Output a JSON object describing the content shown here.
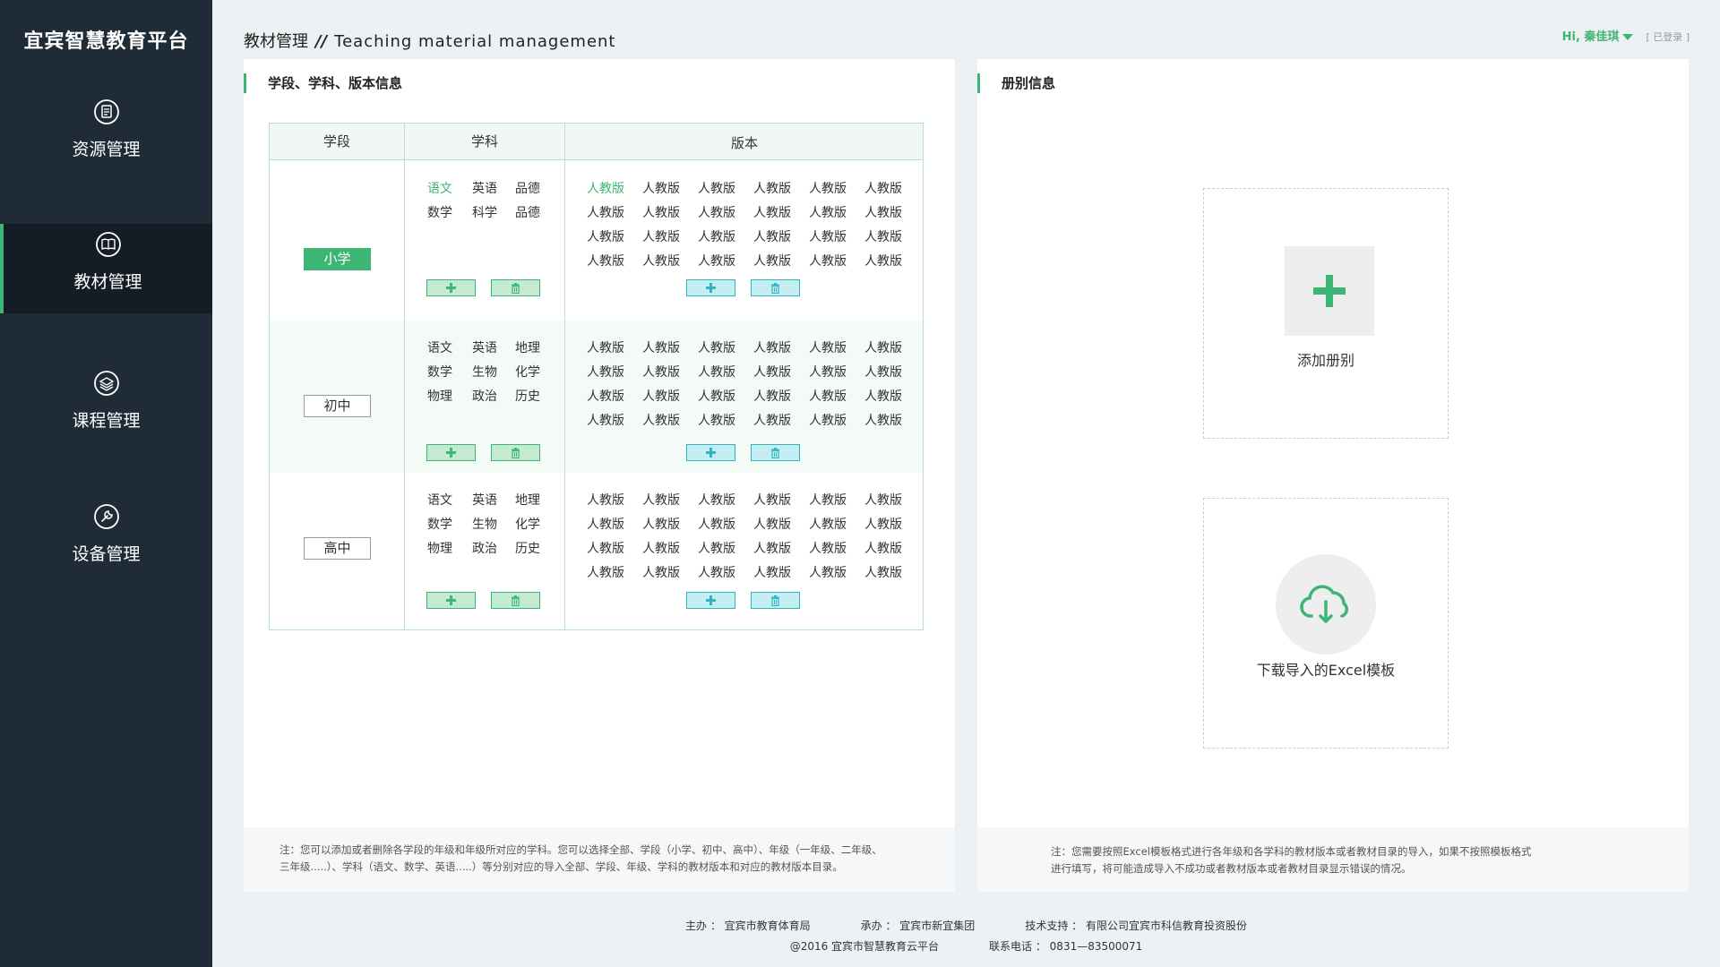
{
  "sidebar": {
    "logo": "宜宾智慧教育平台",
    "items": [
      {
        "label": "资源管理",
        "icon": "document-icon",
        "active": false
      },
      {
        "label": "教材管理",
        "icon": "book-icon",
        "active": true
      },
      {
        "label": "课程管理",
        "icon": "layers-icon",
        "active": false
      },
      {
        "label": "设备管理",
        "icon": "wrench-icon",
        "active": false
      }
    ]
  },
  "header": {
    "title_cn": "教材管理",
    "title_sep": "//",
    "title_en": "Teaching material management",
    "user_greeting": "Hi, 秦佳琪",
    "login_status": "[ 已登录 ]"
  },
  "left_panel": {
    "title": "学段、学科、版本信息",
    "columns": [
      "学段",
      "学科",
      "版本"
    ],
    "sections": [
      {
        "stage": "小学",
        "stage_active": true,
        "subjects": [
          "语文",
          "英语",
          "品德",
          "数学",
          "科学",
          "品德"
        ],
        "selected_subject": "语文",
        "editions": [
          [
            "人教版",
            "人教版",
            "人教版",
            "人教版",
            "人教版",
            "人教版"
          ],
          [
            "人教版",
            "人教版",
            "人教版",
            "人教版",
            "人教版",
            "人教版"
          ],
          [
            "人教版",
            "人教版",
            "人教版",
            "人教版",
            "人教版",
            "人教版"
          ],
          [
            "人教版",
            "人教版",
            "人教版",
            "人教版",
            "人教版",
            "人教版"
          ]
        ]
      },
      {
        "stage": "初中",
        "stage_active": false,
        "subjects": [
          "语文",
          "英语",
          "地理",
          "数学",
          "生物",
          "化学",
          "物理",
          "政治",
          "历史"
        ],
        "editions": [
          [
            "人教版",
            "人教版",
            "人教版",
            "人教版",
            "人教版",
            "人教版"
          ],
          [
            "人教版",
            "人教版",
            "人教版",
            "人教版",
            "人教版",
            "人教版"
          ],
          [
            "人教版",
            "人教版",
            "人教版",
            "人教版",
            "人教版",
            "人教版"
          ],
          [
            "人教版",
            "人教版",
            "人教版",
            "人教版",
            "人教版",
            "人教版"
          ]
        ]
      },
      {
        "stage": "高中",
        "stage_active": false,
        "subjects": [
          "语文",
          "英语",
          "地理",
          "数学",
          "生物",
          "化学",
          "物理",
          "政治",
          "历史"
        ],
        "editions": [
          [
            "人教版",
            "人教版",
            "人教版",
            "人教版",
            "人教版",
            "人教版"
          ],
          [
            "人教版",
            "人教版",
            "人教版",
            "人教版",
            "人教版",
            "人教版"
          ],
          [
            "人教版",
            "人教版",
            "人教版",
            "人教版",
            "人教版",
            "人教版"
          ],
          [
            "人教版",
            "人教版",
            "人教版",
            "人教版",
            "人教版",
            "人教版"
          ]
        ]
      }
    ],
    "note_line1": "注：您可以添加或者删除各学段的年级和年级所对应的学科。您可以选择全部、学段（小学、初中、高中）、年级（一年级、二年级、",
    "note_line2": "三年级.....）、学科（语文、数学、英语.....）等分别对应的导入全部、学段、年级、学科的教材版本和对应的教材版本目录。"
  },
  "right_panel": {
    "title": "册别信息",
    "add_label": "添加册别",
    "download_label": "下载导入的Excel模板",
    "note_line1": "注：您需要按照Excel模板格式进行各年级和各学科的教材版本或者教材目录的导入，如果不按照模板格式",
    "note_line2": "进行填写，将可能造成导入不成功或者教材版本或者教材目录显示错误的情况。"
  },
  "footer": {
    "host": "主办 ： 宜宾市教育体育局",
    "organizer": "承办 ： 宜宾市新宜集团",
    "tech": "技术支持 ： 有限公司宜宾市科信教育投资股份",
    "copyright": "@2016  宜宾市智慧教育云平台",
    "phone": "联系电话 ： 0831—83500071"
  },
  "colors": {
    "accent": "#3db574",
    "sidebar_bg": "#1f2b36",
    "sidebar_active_bg": "#141d25",
    "table_border": "#b9e0c9",
    "edition_btn": "#2fb5c2"
  }
}
